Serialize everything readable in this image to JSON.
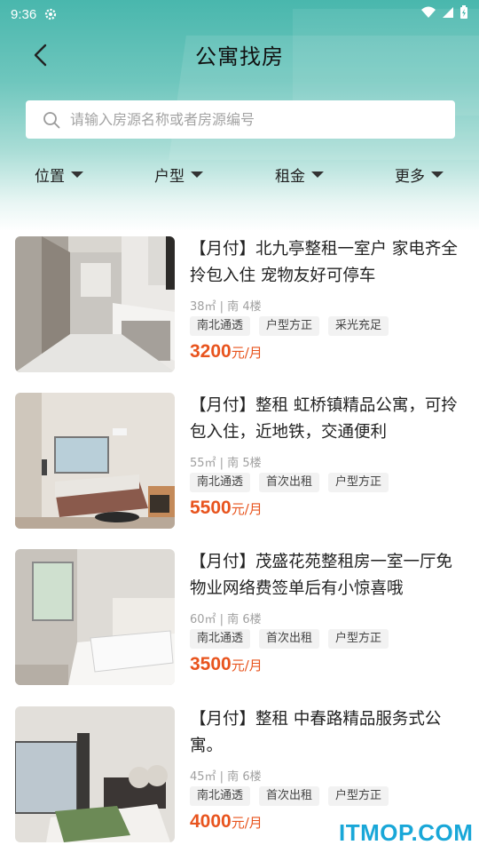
{
  "status_bar": {
    "time": "9:36"
  },
  "header": {
    "title": "公寓找房"
  },
  "search": {
    "placeholder": "请输入房源名称或者房源编号"
  },
  "filters": [
    {
      "label": "位置"
    },
    {
      "label": "户型"
    },
    {
      "label": "租金"
    },
    {
      "label": "更多"
    }
  ],
  "listings": [
    {
      "title": "【月付】北九亭整租一室户 家电齐全拎包入住 宠物友好可停车",
      "meta": "38㎡ | 南  4楼",
      "tags": [
        "南北通透",
        "户型方正",
        "采光充足"
      ],
      "price": "3200",
      "unit": "元/月"
    },
    {
      "title": "【月付】整租 虹桥镇精品公寓，可拎包入住，近地铁，交通便利",
      "meta": "55㎡ | 南  5楼",
      "tags": [
        "南北通透",
        "首次出租",
        "户型方正"
      ],
      "price": "5500",
      "unit": "元/月"
    },
    {
      "title": "【月付】茂盛花苑整租房一室一厅免物业网络费签单后有小惊喜哦",
      "meta": "60㎡ | 南  6楼",
      "tags": [
        "南北通透",
        "首次出租",
        "户型方正"
      ],
      "price": "3500",
      "unit": "元/月"
    },
    {
      "title": "【月付】整租 中春路精品服务式公寓。",
      "meta": "45㎡ | 南  6楼",
      "tags": [
        "南北通透",
        "首次出租",
        "户型方正"
      ],
      "price": "4000",
      "unit": "元/月"
    }
  ],
  "watermark": "ITMOP.COM",
  "colors": {
    "accent": "#4ab6ac",
    "price": "#e8541e",
    "watermark": "#19a7d8"
  }
}
